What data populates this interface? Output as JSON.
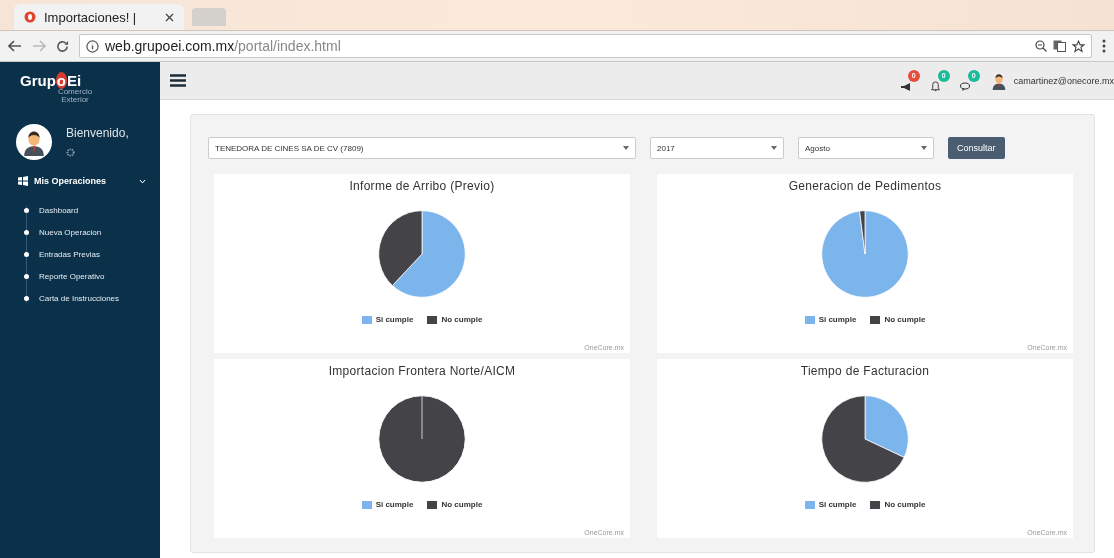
{
  "browser": {
    "tab_title": "Importaciones! |",
    "url_host": "web.grupoei.com.mx",
    "url_path": "/portal/index.html"
  },
  "sidebar": {
    "logo_parts": [
      "Grup",
      "o",
      "Ei"
    ],
    "logo_subtitle": [
      "Comercio",
      "Exterior"
    ],
    "welcome": "Bienvenido,",
    "menu": {
      "label": "Mis Operaciones",
      "expanded": true,
      "children": [
        {
          "label": "Dashboard"
        },
        {
          "label": "Nueva Operacion"
        },
        {
          "label": "Entradas Previas"
        },
        {
          "label": "Reporte Operativo"
        },
        {
          "label": "Carta de Instrucciones"
        }
      ]
    }
  },
  "header": {
    "notifications": [
      {
        "kind": "megaphone",
        "count": "0",
        "color": "#e74c3c"
      },
      {
        "kind": "bell",
        "count": "0",
        "color": "#1abc9c"
      },
      {
        "kind": "chat",
        "count": "0",
        "color": "#1abc9c"
      }
    ],
    "user": "camartinez@onecore.mx"
  },
  "filters": {
    "company": "TENEDORA DE CINES SA DE CV (7809)",
    "year": "2017",
    "month": "Agosto",
    "button": "Consultar"
  },
  "charts": [
    {
      "title": "Informe de Arribo (Previo)",
      "legend": [
        {
          "label": "Si cumple",
          "color": "#7cb5ec"
        },
        {
          "label": "No cumple",
          "color": "#434348"
        }
      ],
      "credit": "OneCore.mx"
    },
    {
      "title": "Generacion de Pedimentos",
      "legend": [
        {
          "label": "Si cumple",
          "color": "#7cb5ec"
        },
        {
          "label": "No cumple",
          "color": "#434348"
        }
      ],
      "credit": "OneCore.mx"
    },
    {
      "title": "Importacion Frontera Norte/AICM",
      "legend": [
        {
          "label": "Si cumple",
          "color": "#7cb5ec"
        },
        {
          "label": "No cumple",
          "color": "#434348"
        }
      ],
      "credit": "OneCore.mx"
    },
    {
      "title": "Tiempo de Facturacion",
      "legend": [
        {
          "label": "Si cumple",
          "color": "#7cb5ec"
        },
        {
          "label": "No cumple",
          "color": "#434348"
        }
      ],
      "credit": "OneCore.mx"
    }
  ]
}
